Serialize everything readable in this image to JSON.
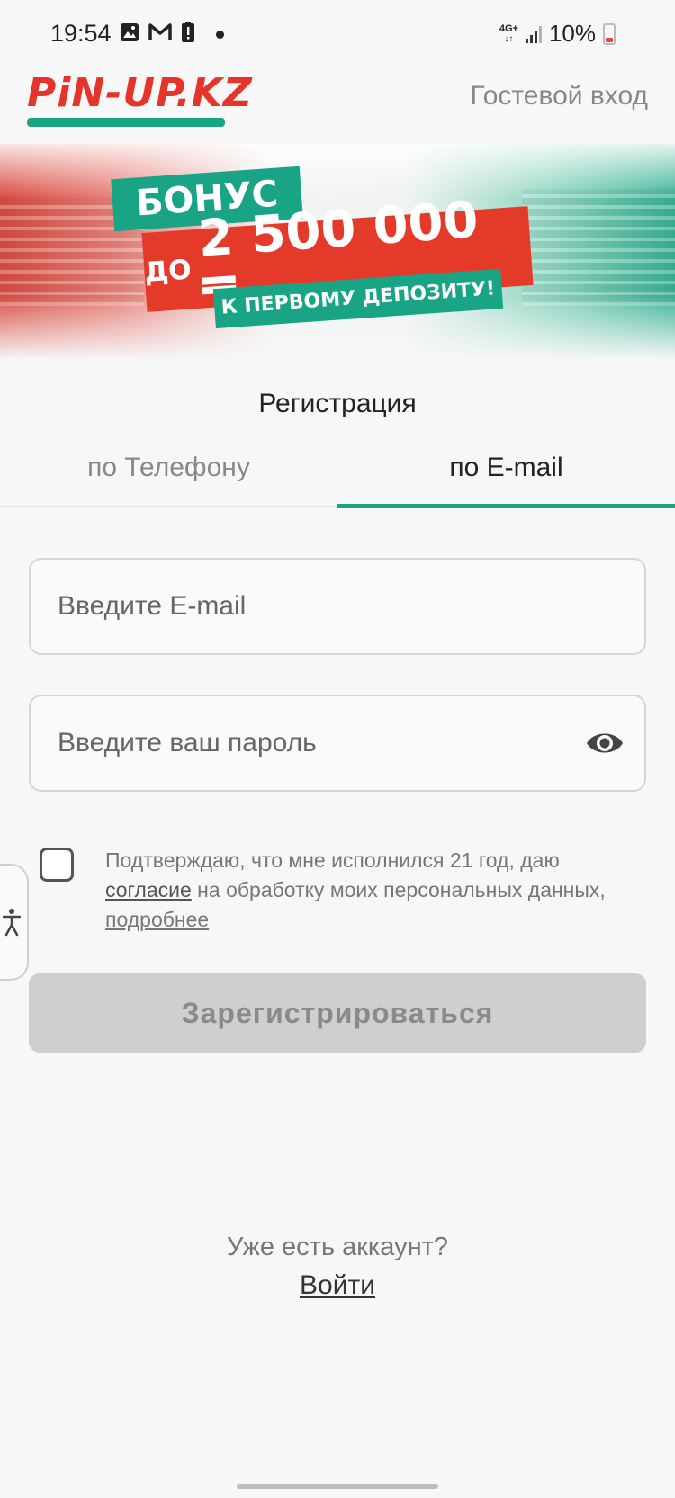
{
  "status_bar": {
    "time": "19:54",
    "network": "4G+",
    "battery": "10%",
    "icons": [
      "image-icon",
      "gmail-icon",
      "battery-alert-icon",
      "dot-icon"
    ]
  },
  "header": {
    "logo_text": "PiN-UP.KZ",
    "guest_login": "Гостевой вход"
  },
  "banner": {
    "line1": "БОНУС",
    "line2_prefix": "ДО",
    "line2_amount": "2 500 000 ₸",
    "line3": "К ПЕРВОМУ ДЕПОЗИТУ!"
  },
  "registration": {
    "title": "Регистрация",
    "tabs": [
      {
        "label": "по Телефону",
        "active": false
      },
      {
        "label": "по E-mail",
        "active": true
      }
    ],
    "email_placeholder": "Введите E-mail",
    "password_placeholder": "Введите ваш пароль",
    "consent": {
      "text_before": "Подтверждаю, что мне исполнился 21 год, даю ",
      "link_consent": "согласие",
      "text_after": " на обработку моих персональных данных, ",
      "link_more": "подробнее"
    },
    "submit_label": "Зарегистрироваться"
  },
  "footer": {
    "have_account": "Уже есть аккаунт?",
    "login_link": "Войти"
  },
  "colors": {
    "brand_red": "#e5342a",
    "brand_green": "#19a585",
    "disabled_button": "#cfcfcf"
  }
}
